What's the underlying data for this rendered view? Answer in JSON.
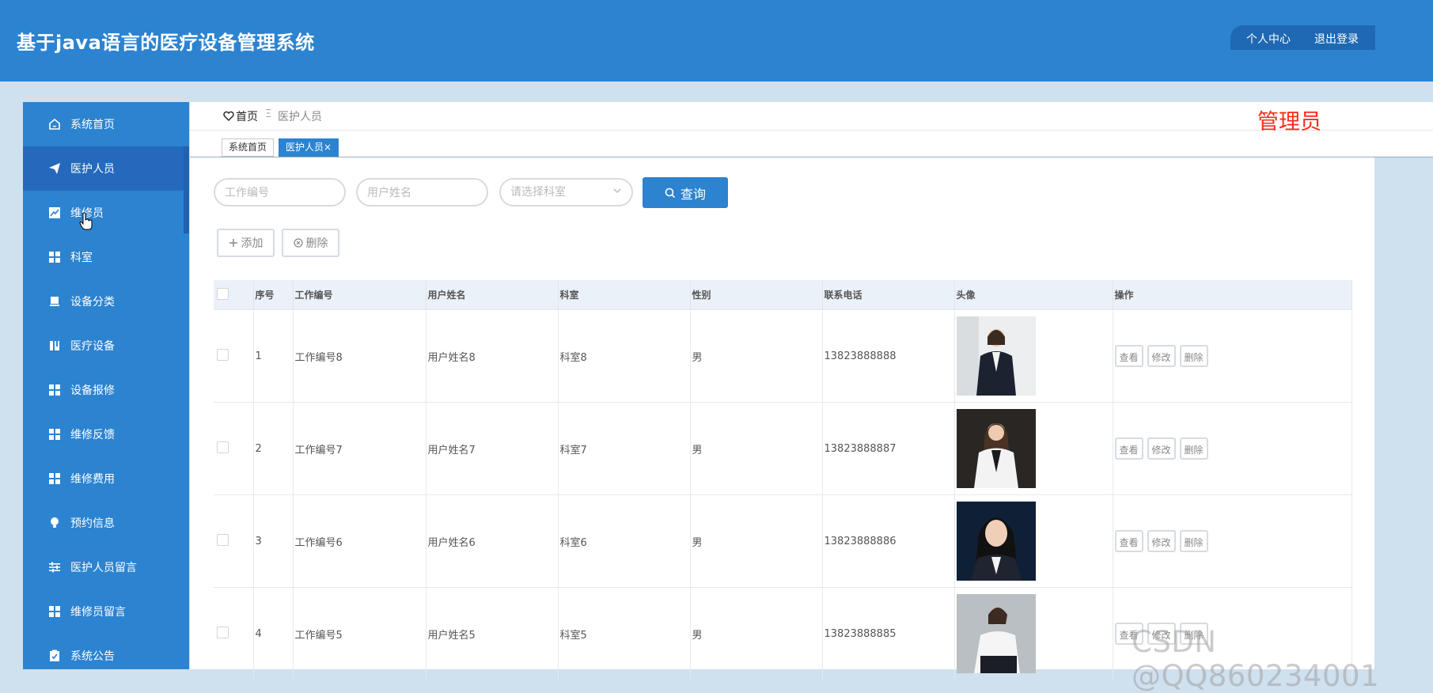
{
  "header": {
    "title": "基于java语言的医疗设备管理系统",
    "profile": "个人中心",
    "logout": "退出登录"
  },
  "sidebar": {
    "items": [
      {
        "label": "系统首页",
        "icon": "home-icon"
      },
      {
        "label": "医护人员",
        "icon": "paper-plane-icon"
      },
      {
        "label": "维修员",
        "icon": "chart-icon"
      },
      {
        "label": "科室",
        "icon": "grid-icon"
      },
      {
        "label": "设备分类",
        "icon": "tray-icon"
      },
      {
        "label": "医疗设备",
        "icon": "book-icon"
      },
      {
        "label": "设备报修",
        "icon": "grid-icon"
      },
      {
        "label": "维修反馈",
        "icon": "grid-icon"
      },
      {
        "label": "维修费用",
        "icon": "grid-icon"
      },
      {
        "label": "预约信息",
        "icon": "bulb-icon"
      },
      {
        "label": "医护人员留言",
        "icon": "sliders-icon"
      },
      {
        "label": "维修员留言",
        "icon": "grid-icon"
      },
      {
        "label": "系统公告",
        "icon": "clipboard-icon"
      }
    ]
  },
  "breadcrumb": {
    "home": "首页",
    "sep": "Ξ",
    "current": "医护人员"
  },
  "role_label": "管理员",
  "tabs": [
    {
      "label": "系统首页"
    },
    {
      "label": "医护人员×"
    }
  ],
  "search": {
    "work_id_placeholder": "工作编号",
    "username_placeholder": "用户姓名",
    "dept_placeholder": "请选择科室",
    "query_label": "查询"
  },
  "actions": {
    "add_label": "添加",
    "delete_label": "删除"
  },
  "table": {
    "headers": [
      "序号",
      "工作编号",
      "用户姓名",
      "科室",
      "性别",
      "联系电话",
      "头像",
      "操作"
    ],
    "row_actions": {
      "view": "查看",
      "edit": "修改",
      "delete": "删除"
    },
    "rows": [
      {
        "no": "1",
        "work_id": "工作编号8",
        "name": "用户姓名8",
        "dept": "科室8",
        "gender": "男",
        "phone": "13823888888"
      },
      {
        "no": "2",
        "work_id": "工作编号7",
        "name": "用户姓名7",
        "dept": "科室7",
        "gender": "男",
        "phone": "13823888887"
      },
      {
        "no": "3",
        "work_id": "工作编号6",
        "name": "用户姓名6",
        "dept": "科室6",
        "gender": "男",
        "phone": "13823888886"
      },
      {
        "no": "4",
        "work_id": "工作编号5",
        "name": "用户姓名5",
        "dept": "科室5",
        "gender": "男",
        "phone": "13823888885"
      }
    ]
  },
  "watermark": "CSDN @QQ860234001"
}
